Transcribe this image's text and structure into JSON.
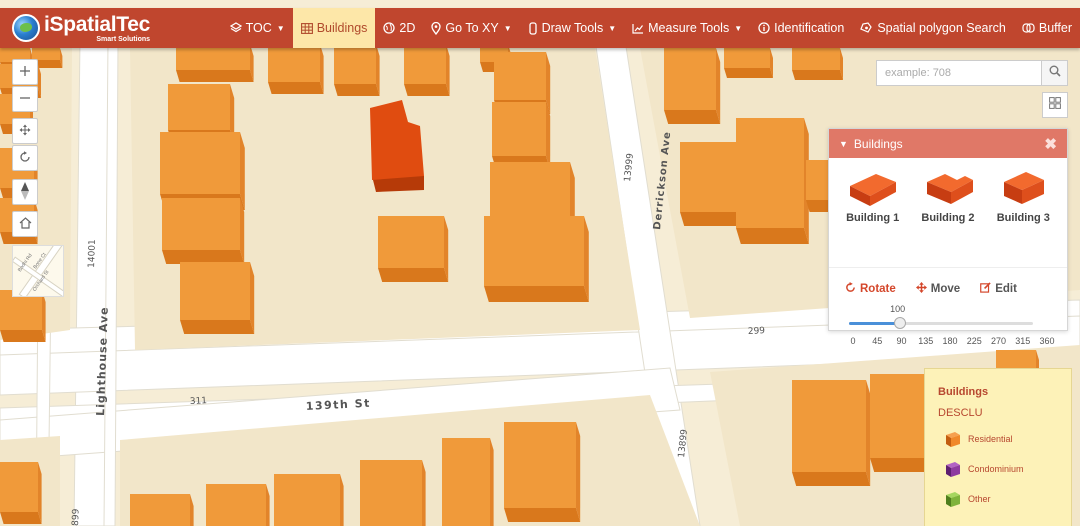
{
  "app": {
    "brand": "iSpatialTec",
    "tagline": "Smart Solutions"
  },
  "nav": {
    "items": [
      {
        "label": "TOC",
        "icon": "layers-icon",
        "caret": true,
        "active": false
      },
      {
        "label": "Buildings",
        "icon": "table-icon",
        "caret": false,
        "active": true
      },
      {
        "label": "2D",
        "icon": "globe-icon",
        "caret": false,
        "active": false
      },
      {
        "label": "Go To XY",
        "icon": "map-marker-icon",
        "caret": true,
        "active": false
      },
      {
        "label": "Draw Tools",
        "icon": "pencil-shape-icon",
        "caret": true,
        "active": false
      },
      {
        "label": "Measure Tools",
        "icon": "chart-line-icon",
        "caret": true,
        "active": false
      },
      {
        "label": "Identification",
        "icon": "info-circle-icon",
        "caret": false,
        "active": false
      },
      {
        "label": "Spatial polygon Search",
        "icon": "polygon-search-icon",
        "caret": false,
        "active": false
      },
      {
        "label": "Buffer",
        "icon": "buffer-icon",
        "caret": false,
        "active": false
      }
    ]
  },
  "search": {
    "placeholder": "example: 708",
    "value": ""
  },
  "map": {
    "street_labels": [
      "Lighthouse Ave",
      "139th St",
      "Derrickson Ave"
    ],
    "number_labels": [
      "14001",
      "13999",
      "13899",
      "311",
      "299",
      "899"
    ],
    "minimap_labels": [
      "Bodhi Rd",
      "Bone Ct",
      "Orchard St"
    ],
    "colors": {
      "building": "#f09a3a",
      "selected_building": "#e04c10",
      "block": "#f6edd6",
      "street": "#ffffff"
    }
  },
  "buildings_panel": {
    "title": "Buildings",
    "tiles": [
      "Building 1",
      "Building 2",
      "Building 3"
    ],
    "tools": [
      {
        "label": "Rotate",
        "icon": "rotate-icon",
        "active": true
      },
      {
        "label": "Move",
        "icon": "move-icon",
        "active": false
      },
      {
        "label": "Edit",
        "icon": "edit-icon",
        "active": false
      }
    ],
    "rotation": {
      "value": 100,
      "value_label": "100",
      "min": 0,
      "max": 360,
      "ticks": [
        "0",
        "45",
        "90",
        "135",
        "180",
        "225",
        "270",
        "315",
        "360"
      ]
    }
  },
  "legend": {
    "title": "Buildings",
    "field": "DESCLU",
    "items": [
      {
        "label": "Residential",
        "color": "#f0882a"
      },
      {
        "label": "Condominium",
        "color": "#8e3aa0"
      },
      {
        "label": "Other",
        "color": "#7fb33b"
      }
    ]
  }
}
